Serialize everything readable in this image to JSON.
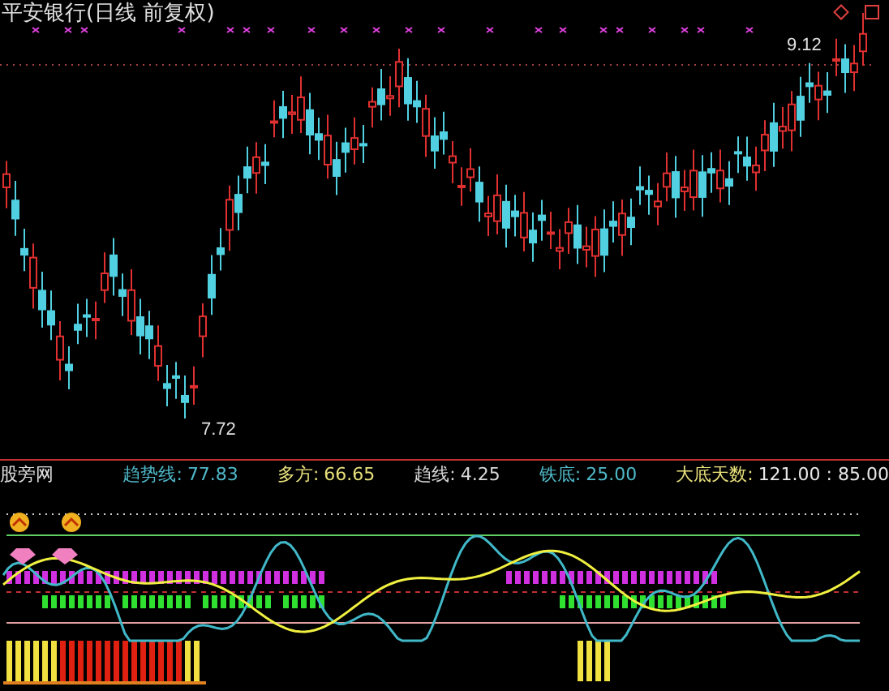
{
  "main_chart": {
    "title": "平安银行(日线 前复权)",
    "high_label": "9.12",
    "low_label": "7.72"
  },
  "indicator": {
    "name": "股旁网",
    "legend_items": [
      {
        "kind": "label",
        "text": "趋势线:",
        "color": "#4fb8c8"
      },
      {
        "kind": "value",
        "text": "77.83",
        "color": "#4fb8c8"
      },
      {
        "kind": "label",
        "text": "多方:",
        "color": "#e8e07a"
      },
      {
        "kind": "value",
        "text": "66.65",
        "color": "#e8e07a"
      },
      {
        "kind": "label",
        "text": "趋线:",
        "color": "#d8d8d8"
      },
      {
        "kind": "value",
        "text": "4.25",
        "color": "#d8d8d8"
      },
      {
        "kind": "label",
        "text": "铁底:",
        "color": "#4fb8c8"
      },
      {
        "kind": "value",
        "text": "25.00",
        "color": "#4fb8c8"
      },
      {
        "kind": "label",
        "text": "大底天数:",
        "color": "#e8e07a"
      },
      {
        "kind": "value",
        "text": "121.00 : 85.00",
        "color": "#e8e8e8"
      }
    ]
  }
}
